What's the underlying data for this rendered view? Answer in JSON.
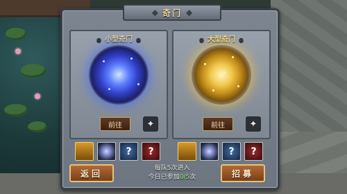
{
  "dialog": {
    "title": "奇门",
    "left_panel": {
      "header": "小型奇门",
      "go_label": "前往"
    },
    "right_panel": {
      "header": "大型奇门",
      "go_label": "前往"
    },
    "back_label": "返回",
    "recruit_label": "招募",
    "info_line1": "每队5次进入",
    "info_prefix": "今日已参加",
    "info_count": "0/5",
    "info_suffix": "次"
  },
  "icons": {
    "orb_left": "blue-energy-orb-icon",
    "orb_right": "gold-energy-orb-icon",
    "reward_chest": "treasure-chest-icon",
    "reward_gem": "dark-gem-icon",
    "reward_unknown": "question-mark-icon",
    "sparkle": "sparkle-icon"
  },
  "colors": {
    "title_gold": "#f0d9a0",
    "count_green": "#9cf06b"
  }
}
